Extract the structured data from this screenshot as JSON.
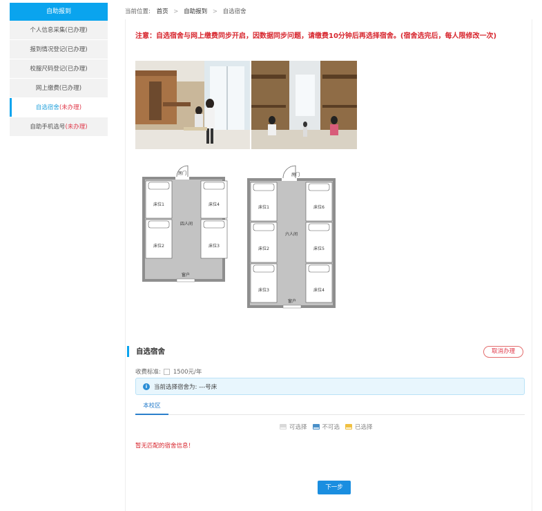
{
  "sidebar": {
    "header": "自助报到",
    "items": [
      {
        "label": "个人信息采集(已办理)"
      },
      {
        "label": "报到情况登记(已办理)"
      },
      {
        "label": "校服尺码登记(已办理)"
      },
      {
        "label": "网上缴费(已办理)"
      },
      {
        "label_main": "自选宿舍",
        "label_status": "(未办理)"
      },
      {
        "label_main": "自助手机选号",
        "label_status": "(未办理)"
      }
    ]
  },
  "breadcrumb": {
    "prefix": "当前位置:",
    "home": "首页",
    "section": "自助报到",
    "current": "自选宿舍",
    "sep": ">"
  },
  "notice": "注意：自选宿舍与网上缴费同步开启，因数据同步问题，请缴费10分钟后再选择宿舍。(宿舍选完后，每人限修改一次)",
  "floor_plan_4": {
    "door": "房门",
    "room": "四人间",
    "window": "窗户",
    "beds": [
      "床位1",
      "床位4",
      "床位2",
      "床位3"
    ]
  },
  "floor_plan_6": {
    "door": "房门",
    "room": "六人间",
    "window": "窗户",
    "beds": [
      "床位1",
      "床位6",
      "床位2",
      "床位5",
      "床位3",
      "床位4"
    ]
  },
  "dorm": {
    "title": "自选宿舍",
    "cancel": "取消办理",
    "fee_label": "收费标准:",
    "fee_value": "1500元/年",
    "selected_info": "当前选择宿舍为: ---号床",
    "tab": "本校区",
    "legend": [
      {
        "label": "可选择",
        "color": "#d9d9d9"
      },
      {
        "label": "不可选",
        "color": "#4a90c8"
      },
      {
        "label": "已选择",
        "color": "#f0c040"
      }
    ],
    "empty": "暂无匹配的宿舍信息！",
    "next": "下一步"
  }
}
